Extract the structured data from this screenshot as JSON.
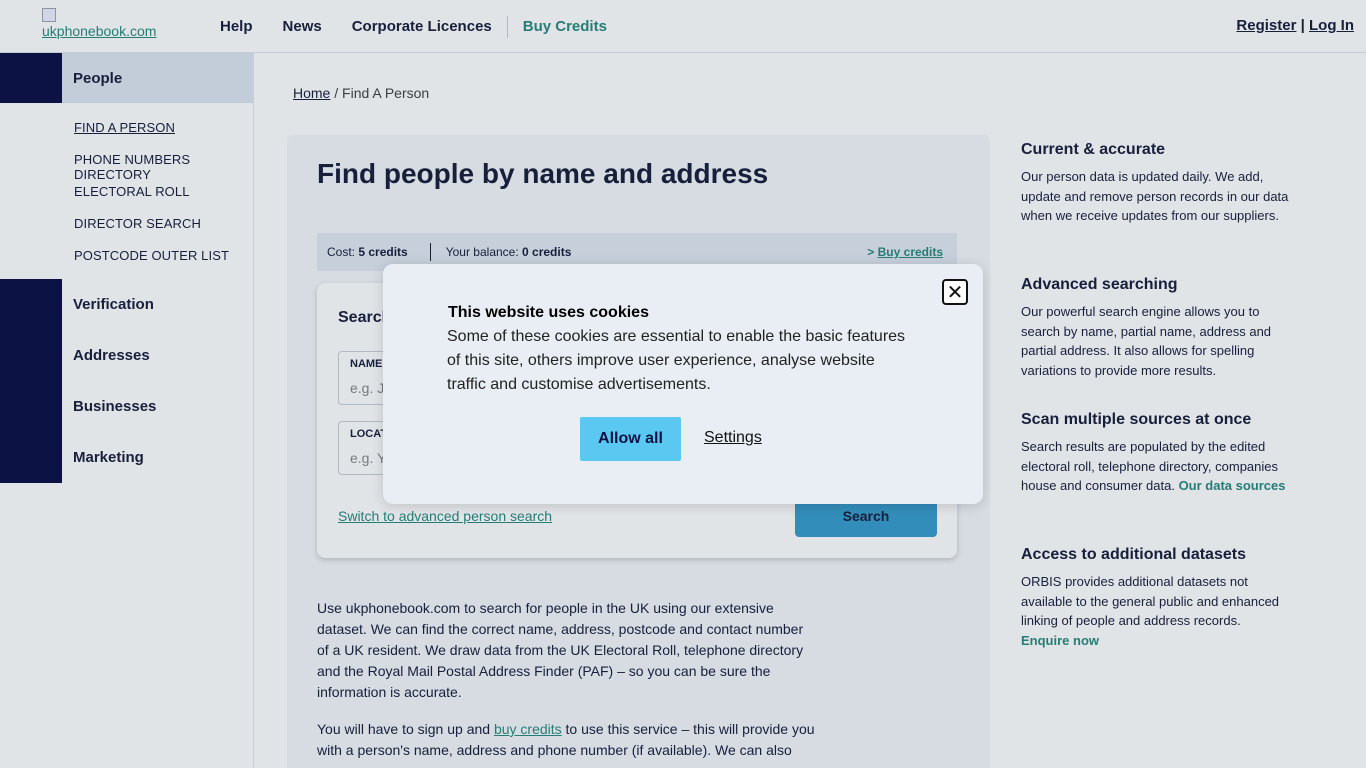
{
  "header": {
    "logo_alt": "ukphonebook.com",
    "nav": [
      "Help",
      "News",
      "Corporate Licences",
      "Buy Credits"
    ],
    "register": "Register",
    "divider": "|",
    "login": "Log In"
  },
  "sidebar": {
    "sections": [
      {
        "label": "People",
        "expanded": true
      },
      {
        "label": "Verification"
      },
      {
        "label": "Addresses"
      },
      {
        "label": "Businesses"
      },
      {
        "label": "Marketing"
      }
    ],
    "people_items": [
      "FIND A PERSON",
      "PHONE NUMBERS DIRECTORY",
      "ELECTORAL ROLL",
      "DIRECTOR SEARCH",
      "POSTCODE OUTER LIST"
    ],
    "chevron": "",
    "social_icons": [
      "",
      ""
    ]
  },
  "breadcrumb": {
    "home": "Home",
    "sep": " / ",
    "current": "Find A Person"
  },
  "main": {
    "title": "Find people by name and address",
    "cost_label": "Cost:",
    "cost_value": "5 credits",
    "balance_label": "Your balance:",
    "balance_value": "0 credits",
    "buy_prefix": "> ",
    "buy_link": "Buy credits",
    "search_heading": "Search",
    "name_label": "NAME",
    "name_placeholder": "e.g. J",
    "location_label": "LOCAT",
    "location_placeholder": "e.g. Y",
    "advanced_link": "Switch to advanced person search",
    "search_button": "Search",
    "intro_p1": "Use ukphonebook.com to search for people in the UK using our extensive dataset. We can find the correct name, address, postcode and contact number of a UK resident. We draw data from the UK Electoral Roll, telephone directory and the Royal Mail Postal Address Finder (PAF) – so you can be sure the information is accurate.",
    "intro_p2_a": "You will have to sign up and ",
    "intro_p2_link": "buy credits",
    "intro_p2_b": " to use this service – this will provide you with a person's name, address and phone number (if available). We can also"
  },
  "features": [
    {
      "title": "Current & accurate",
      "text": "Our person data is updated daily. We add, update and remove person records in our data when we receive updates from our suppliers."
    },
    {
      "title": "Advanced searching",
      "text": "Our powerful search engine allows you to search by name, partial name, address and partial address. It also allows for spelling variations to provide more results."
    },
    {
      "title": "Scan multiple sources at once",
      "text": "Search results are populated by the edited electoral roll, telephone directory, companies house and consumer data. ",
      "link": "Our data sources "
    },
    {
      "title": "Access to additional datasets",
      "text": "ORBIS provides additional datasets not available to the general public and enhanced linking of people and address records.",
      "link": "Enquire now "
    }
  ],
  "cookie": {
    "title": "This website uses cookies",
    "body": "Some of these cookies are essential to enable the basic features of this site, others improve user experience, analyse website traffic and customise advertisements.",
    "allow": "Allow all",
    "settings": "Settings",
    "close_symbol": "✕"
  }
}
